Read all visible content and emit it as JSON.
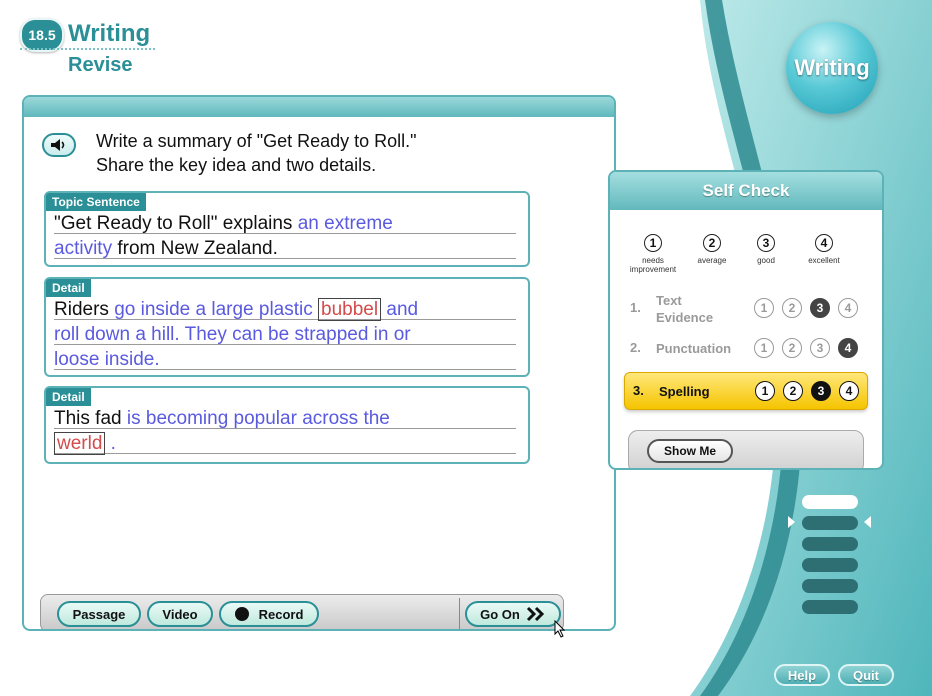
{
  "header": {
    "lesson_number": "18.5",
    "title": "Writing",
    "subtitle": "Revise",
    "badge_label": "Writing"
  },
  "prompt": {
    "line1": "Write a summary of \"Get Ready to Roll.\"",
    "line2": "Share the key idea and two details."
  },
  "sections": [
    {
      "label": "Topic Sentence",
      "parts": {
        "a": "\"Get Ready to Roll\" explains ",
        "b": "an extreme",
        "c": "activity ",
        "d": "from New Zealand."
      }
    },
    {
      "label": "Detail",
      "parts": {
        "a": "Riders ",
        "b": "go inside a large plastic ",
        "err": "bubbel",
        "c": " and",
        "d": "roll down a hill. They can be strapped in or",
        "e": "loose inside."
      }
    },
    {
      "label": "Detail",
      "parts": {
        "a": "This fad ",
        "b": "is becoming popular across the",
        "err": "werld",
        "c": " ."
      }
    }
  ],
  "toolbar": {
    "passage": "Passage",
    "video": "Video",
    "record": "Record",
    "go_on": "Go On",
    "go_on_icon": "double-chevron-right-icon"
  },
  "self_check": {
    "title": "Self Check",
    "scale": [
      {
        "num": "1",
        "label": "needs improvement"
      },
      {
        "num": "2",
        "label": "average"
      },
      {
        "num": "3",
        "label": "good"
      },
      {
        "num": "4",
        "label": "excellent"
      }
    ],
    "criteria": [
      {
        "num": "1.",
        "label_line1": "Text",
        "label_line2": "Evidence",
        "selected": 3
      },
      {
        "num": "2.",
        "label": "Punctuation",
        "selected": 4
      },
      {
        "num": "3.",
        "label": "Spelling",
        "selected": 3,
        "active": true
      }
    ],
    "show_me": "Show Me"
  },
  "progress": {
    "total": 6,
    "completed": 1,
    "current": 2
  },
  "footer": {
    "help": "Help",
    "quit": "Quit"
  },
  "colors": {
    "teal": "#2a8f96",
    "highlight": "#f5c400",
    "fill_text": "#5a5ae0",
    "error_text": "#d34b4b"
  }
}
